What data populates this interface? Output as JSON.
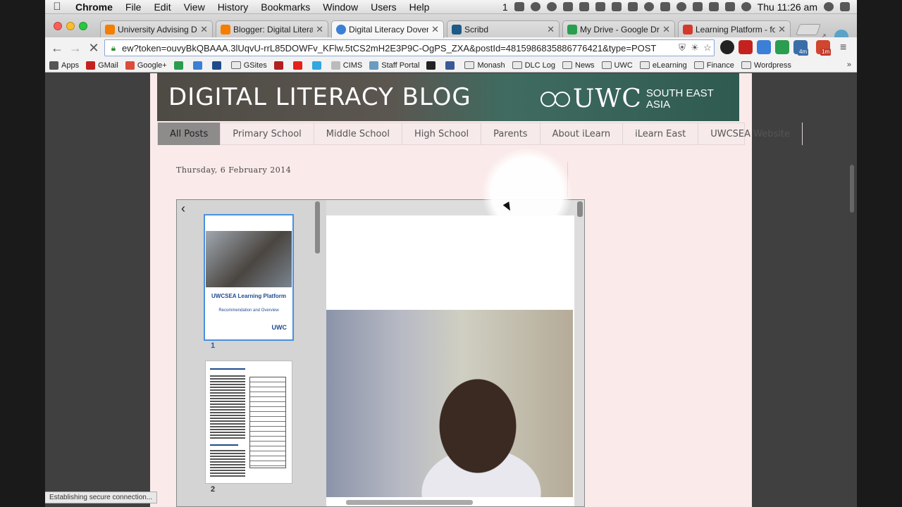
{
  "menubar": {
    "app": "Chrome",
    "items": [
      "File",
      "Edit",
      "View",
      "History",
      "Bookmarks",
      "Window",
      "Users",
      "Help"
    ],
    "status_extra": "1",
    "clock": "Thu 11:26 am"
  },
  "tabs": [
    {
      "title": "University Advising Dov",
      "favicon_color": "#f57d00",
      "active": false
    },
    {
      "title": "Blogger: Digital Literacy",
      "favicon_color": "#f57d00",
      "active": false
    },
    {
      "title": "Digital Literacy Dover: P",
      "favicon_color": "#3b7fd6",
      "active": true
    },
    {
      "title": "Scribd",
      "favicon_color": "#1d5a87",
      "active": false
    },
    {
      "title": "My Drive - Google Drive",
      "favicon_color": "#2a9d4f",
      "active": false
    },
    {
      "title": "Learning Platform - for i",
      "favicon_color": "#d33a2c",
      "active": false
    }
  ],
  "toolbar": {
    "url": "ew?token=ouvyBkQBAAA.3lUqvU-rrL85DOWFv_KFlw.5tCS2mH2E3P9C-OgPS_ZXA&postId=4815986835886776421&type=POST",
    "ext_badges": [
      "4m",
      "1m"
    ]
  },
  "bookmarks": [
    {
      "label": "Apps",
      "type": "apps",
      "color": "#555555"
    },
    {
      "label": "GMail",
      "type": "site",
      "color": "#c5221f"
    },
    {
      "label": "Google+",
      "type": "site",
      "color": "#dd4b39"
    },
    {
      "label": "",
      "type": "site",
      "color": "#2a9d4f"
    },
    {
      "label": "",
      "type": "site",
      "color": "#3b7fd6"
    },
    {
      "label": "",
      "type": "site",
      "color": "#1f4b8c"
    },
    {
      "label": "GSites",
      "type": "folder",
      "color": "#666666"
    },
    {
      "label": "",
      "type": "site",
      "color": "#b11f1f"
    },
    {
      "label": "",
      "type": "site",
      "color": "#e62117"
    },
    {
      "label": "",
      "type": "site",
      "color": "#2fa7e0"
    },
    {
      "label": "CIMS",
      "type": "site",
      "color": "#bbbbbb"
    },
    {
      "label": "Staff Portal",
      "type": "site",
      "color": "#6a9bc0"
    },
    {
      "label": "",
      "type": "site",
      "color": "#222222"
    },
    {
      "label": "",
      "type": "site",
      "color": "#3b5998"
    },
    {
      "label": "Monash",
      "type": "folder",
      "color": "#666666"
    },
    {
      "label": "DLC Log",
      "type": "folder",
      "color": "#666666"
    },
    {
      "label": "News",
      "type": "folder",
      "color": "#666666"
    },
    {
      "label": "UWC",
      "type": "folder",
      "color": "#666666"
    },
    {
      "label": "eLearning",
      "type": "folder",
      "color": "#666666"
    },
    {
      "label": "Finance",
      "type": "folder",
      "color": "#666666"
    },
    {
      "label": "Wordpress",
      "type": "folder",
      "color": "#666666"
    }
  ],
  "blog": {
    "title": "DIGITAL LITERACY BLOG",
    "logo_main": "UWC",
    "logo_sub_line1": "SOUTH EAST",
    "logo_sub_line2": "ASIA",
    "nav": [
      "All Posts",
      "Primary School",
      "Middle School",
      "High School",
      "Parents",
      "About iLearn",
      "iLearn East",
      "UWCSEA Website"
    ],
    "active_nav": 0,
    "post_date": "Thursday, 6 February 2014"
  },
  "viewer": {
    "thumb1_title": "UWCSEA Learning Platform",
    "thumb1_subtitle": "Recommendation and Overview",
    "thumb1_logo": "UWC",
    "page1": "1",
    "page2": "2"
  },
  "status": "Establishing secure connection..."
}
